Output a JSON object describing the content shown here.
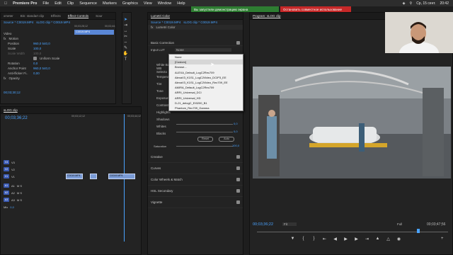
{
  "menubar": {
    "app": "Premiere Pro",
    "items": [
      "File",
      "Edit",
      "Clip",
      "Sequence",
      "Markers",
      "Graphics",
      "View",
      "Window",
      "Help"
    ],
    "status": {
      "date": "Ср, 15 сент.",
      "time": "20:42"
    }
  },
  "banners": {
    "share": "Вы запустили демонстрацию экрана",
    "stop": "Остановить совместное использование"
  },
  "source_panel": {
    "tabs": [
      "xmeter",
      "Bin: standart clip",
      "Effects",
      "Effect Controls",
      "Sour"
    ],
    "source_label": "Source * C0019.MP4",
    "clip_label": "sLOG clip * C0019.MP4",
    "ruler": [
      "00;03;28;12",
      "00;03;44;"
    ],
    "clip_in_bar": "C0019.MP4",
    "timecode": "00;03;30;12",
    "rows": [
      {
        "label": "Video",
        "value": ""
      },
      {
        "label": "Motion",
        "value": ""
      },
      {
        "label": "Position",
        "value": "960,0   540,0"
      },
      {
        "label": "Scale",
        "value": "100,0"
      },
      {
        "label": "Scale Width",
        "value": "100,0"
      },
      {
        "label": "",
        "value": "Uniform Scale"
      },
      {
        "label": "Rotation",
        "value": "0,0"
      },
      {
        "label": "Anchor Point",
        "value": "960,0   540,0"
      },
      {
        "label": "Anti-flicker Fi..",
        "value": "0,00"
      },
      {
        "label": "Opacity",
        "value": ""
      }
    ]
  },
  "lumetri": {
    "tab": "Lumetri Color",
    "source": "Source * C0019.MP4",
    "clip": "sLOG clip * C0019.MP4",
    "title": "Lumetri Color",
    "basic_correction": "Basic Correction",
    "input_lut": "Input LUT",
    "lut_value": "None",
    "left_labels": [
      "White Bal",
      "WB Selecto",
      "Temperatu",
      "Tint",
      "Tone",
      "Exposure",
      "Contrast",
      "Highlights",
      "Shadows",
      "Whites",
      "Blacks"
    ],
    "whites_val": "0,0",
    "blacks_val": "0,0",
    "saturation": "Saturation",
    "saturation_val": "100,0",
    "reset": "Reset",
    "auto": "Auto",
    "sections": [
      "Creative",
      "Curves",
      "Color Wheels & Match",
      "HSL Secondary",
      "Vignette"
    ]
  },
  "lut_menu": {
    "items": [
      "None",
      "[Custom]",
      "Browse...",
      "ALEXA_Default_LogC2Rec709",
      "AlexaV3_K1S1_LogC2Video_DCIP3_EE",
      "AlexaV3_K1S1_LogC2Video_Rec709_EE",
      "AMIRA_Default_LogC2Rec709",
      "ARRI_Universal_DCI",
      "ARRI_Universal_HD",
      "D-21_delogC_EI0200_B1",
      "Phantom_Rec709_Gamma"
    ]
  },
  "program": {
    "title": "Program: sLOG clip",
    "timecode": "00;03;36;22",
    "fit": "Fit",
    "quality": "Full",
    "duration": "00;03;47;56"
  },
  "timeline": {
    "tab": "sLOG clip",
    "timecode": "00;03;36;22",
    "ruler": [
      "00;03;12;12",
      "00;03;44;12"
    ],
    "tracks": [
      "V3",
      "V2",
      "V1",
      "A1",
      "A2",
      "A3",
      "Mix"
    ],
    "mix_val": "0,0",
    "clips": [
      "C0019.MP4",
      "C0019.MP4"
    ]
  }
}
